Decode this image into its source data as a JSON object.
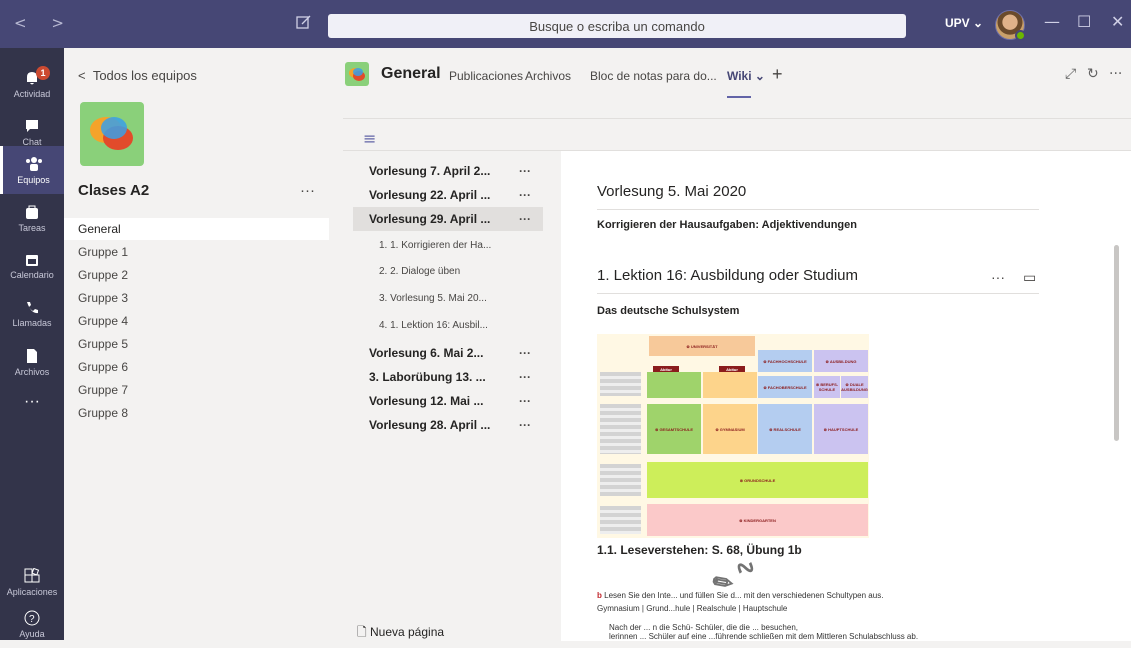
{
  "topbar": {
    "search_placeholder": "Busque o escriba un comando",
    "user_label": "UPV ⌄"
  },
  "rail": [
    {
      "label": "Actividad",
      "badge": "1"
    },
    {
      "label": "Chat"
    },
    {
      "label": "Equipos",
      "active": true
    },
    {
      "label": "Tareas"
    },
    {
      "label": "Calendario"
    },
    {
      "label": "Llamadas"
    },
    {
      "label": "Archivos"
    },
    {
      "label": "···"
    },
    {
      "label": "Aplicaciones"
    },
    {
      "label": "Ayuda"
    }
  ],
  "teams_panel": {
    "back_label": "Todos los equipos",
    "team_name": "Clases A2",
    "channels": [
      "General",
      "Gruppe 1",
      "Gruppe 2",
      "Gruppe 3",
      "Gruppe 4",
      "Gruppe 5",
      "Gruppe 6",
      "Gruppe 7",
      "Gruppe 8"
    ]
  },
  "header": {
    "channel_title": "General",
    "tabs": [
      "Publicaciones",
      "Archivos",
      "Bloc de notas para do...",
      "Wiki ⌄"
    ],
    "add_tab": "+"
  },
  "wiki_nav": {
    "pages": [
      {
        "title": "Vorlesung 7. April 2...",
        "more": "···"
      },
      {
        "title": "Vorlesung 22. April ...",
        "more": "···"
      },
      {
        "title": "Vorlesung 29. April ...",
        "more": "···"
      },
      {
        "title": "Vorlesung 6. Mai 2...",
        "more": "···"
      },
      {
        "title": "3. Laborübung 13. ...",
        "more": "···"
      },
      {
        "title": "Vorlesung 12. Mai ...",
        "more": "···"
      },
      {
        "title": "Vorlesung 28. April ...",
        "more": "···"
      }
    ],
    "subpages": [
      "1. 1. Korrigieren der Ha...",
      "2. 2. Dialoge üben",
      "3. Vorlesung 5. Mai 20...",
      "4. 1. Lektion 16: Ausbil..."
    ],
    "new_page": "Nueva página"
  },
  "article": {
    "title": "Vorlesung 5. Mai 2020",
    "subtitle": "Korrigieren der Hausaufgaben: Adjektivendungen",
    "section_title": "1. Lektion 16: Ausbildung oder Studium",
    "section_more": "···",
    "schema_heading": "Das deutsche Schulsystem",
    "caption": "1.1. Leseverstehen: S. 68, Übung 1b",
    "schema": {
      "universitaet": "⊗ UNIVERSITÄT",
      "fachhochschule": "⊗ FACHHOCHSCHULE",
      "ausbildung": "⊗ AUSBILDUNG",
      "abitur": "Abitur",
      "fachoberschule": "⊗ FACHOBERSCHULE",
      "berufsschule": "⊗ BERUFS-SCHULE",
      "duale": "⊗ DUALE AUSBILDUNG",
      "gesamtschule": "⊗ GESAMTSCHULE",
      "gymnasium": "⊗ GYMNASIUM",
      "realschule": "⊗ REALSCHULE",
      "hauptschule": "⊗ HAUPTSCHULE",
      "grundschule": "⊗ GRUNDSCHULE",
      "kindergarten": "⊗ KINDERGARTEN"
    },
    "scan_line1_letter": "b",
    "scan_line1": "Lesen Sie den Inte... und füllen Sie d... mit den verschiedenen Schultypen aus.",
    "scan_line2": "Gymnasium | Grund...hule | Realschule | Hauptschule",
    "scan_line3": "Nach der ... n die Schü- Schüler, die die ... besuchen,",
    "scan_line4": "lerinnen ... Schüler auf eine ...führende schließen mit dem Mittleren Schulabschluss ab."
  }
}
